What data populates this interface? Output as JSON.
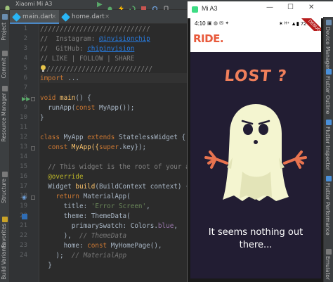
{
  "toolbar": {
    "device": "Xiaomi Mi A3"
  },
  "tabs": [
    {
      "label": "main.dart"
    },
    {
      "label": "home.dart"
    }
  ],
  "left_panel": {
    "project": "Project",
    "commit": "Commit",
    "resource_manager": "Resource Manager",
    "structure": "Structure",
    "favorites": "Favorites",
    "build_variants": "Build Variants"
  },
  "right_panel": {
    "device_manager": "Device Manager",
    "flutter_outline": "Flutter Outline",
    "flutter_inspector": "Flutter Inspector",
    "flutter_performance": "Flutter Performance",
    "emulator": "Emulator"
  },
  "editor": {
    "line_numbers": [
      "1",
      "2",
      "3",
      "4",
      "5",
      "6",
      "7",
      "8",
      "9",
      "10",
      "11",
      "12",
      "13",
      "14",
      "15",
      "16",
      "17",
      "18",
      "19",
      "20",
      "21",
      "22",
      "23",
      "24"
    ],
    "lines": {
      "l1": "////////////////////////////",
      "l2a": "//  Instagram: ",
      "l2b": "@invisionchip",
      "l3a": "//  GitHub: ",
      "l3b": "chipinvision",
      "l4": "// LIKE | FOLLOW | SHARE",
      "l5": "///////////////////////////",
      "l6a": "import",
      "l6b": " ...",
      "l8a": "void ",
      "l8b": "main",
      "l8c": "() {",
      "l9a": "  runApp(",
      "l9b": "const ",
      "l9c": "MyApp());",
      "l10": "}",
      "l12a": "class ",
      "l12b": "MyApp ",
      "l12c": "extends ",
      "l12d": "StatelessWidget {",
      "l13a": "  const ",
      "l13b": "MyApp({",
      "l13c": "super",
      "l13d": ".key});",
      "l15": "  // This widget is the root of your appl",
      "l16": "  @override",
      "l17a": "  Widget ",
      "l17b": "build",
      "l17c": "(BuildContext context) {",
      "l18a": "    ",
      "l18b": "return ",
      "l18c": "MaterialApp(",
      "l19a": "      title: ",
      "l19b": "'Error Screen'",
      "l19c": ",",
      "l20": "      theme: ThemeData(",
      "l21a": "        primarySwatch: Colors.",
      "l21b": "blue",
      "l21c": ",",
      "l22a": "      ), ",
      "l22b": " // ThemeData",
      "l23a": "      home: ",
      "l23b": "const ",
      "l23c": "MyHomePage(),",
      "l24a": "    ); ",
      "l24b": " // MaterialApp",
      "l25": "  }"
    }
  },
  "emulator": {
    "title": "Mi A3",
    "minimize": "—",
    "maximize": "☐",
    "close": "✕",
    "status_time": "4:10",
    "status_icons": "▣ ◍ ✉ ✦",
    "status_right": "✶ ᴴ⁺ ▲▮ 72%",
    "debug": "DEBUG",
    "brand": "RIDE.",
    "heading": "LOST ?",
    "message": "It seems nothing out there..."
  },
  "colors": {
    "app_background": "#221d33",
    "heading": "#f07f5b",
    "brand": "#e85a3c",
    "ghost_body": "#f4f5d0",
    "ghost_arms": "#e8734f"
  }
}
